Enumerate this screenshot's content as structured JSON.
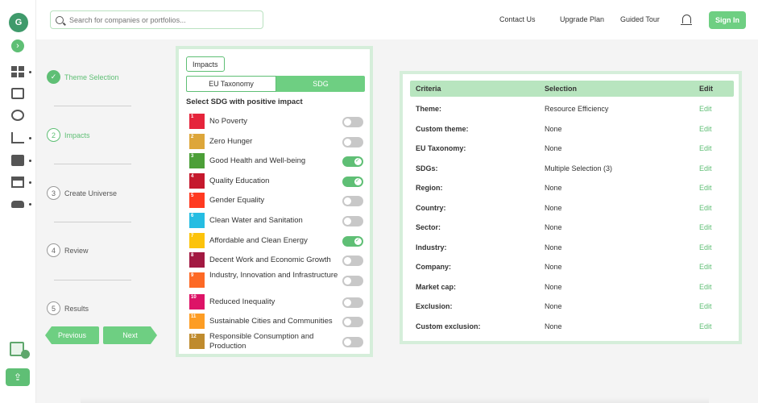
{
  "brand": {
    "logo_text": "G"
  },
  "header": {
    "search_placeholder": "Search for companies or portfolios...",
    "nav": [
      "Contact Us",
      "Upgrade Plan",
      "Guided Tour"
    ],
    "signin_label": "Sign In"
  },
  "steps": [
    {
      "num": "",
      "label": "Theme Selection",
      "state": "done"
    },
    {
      "num": "2",
      "label": "Impacts",
      "state": "active"
    },
    {
      "num": "3",
      "label": "Create Universe",
      "state": "todo"
    },
    {
      "num": "4",
      "label": "Review",
      "state": "todo"
    },
    {
      "num": "5",
      "label": "Results",
      "state": "todo"
    }
  ],
  "nav_buttons": {
    "previous": "Previous",
    "next": "Next"
  },
  "impacts_panel": {
    "tag": "Impacts",
    "tabs": [
      "EU Taxonomy",
      "SDG"
    ],
    "active_tab": "SDG",
    "heading": "Select SDG with positive impact",
    "goals": [
      {
        "num": "1",
        "name": "No Poverty",
        "color": "#e5243b",
        "on": false
      },
      {
        "num": "2",
        "name": "Zero Hunger",
        "color": "#dda63a",
        "on": false
      },
      {
        "num": "3",
        "name": "Good Health and Well-being",
        "color": "#4c9f38",
        "on": true
      },
      {
        "num": "4",
        "name": "Quality Education",
        "color": "#c5192d",
        "on": true
      },
      {
        "num": "5",
        "name": "Gender Equality",
        "color": "#ff3a21",
        "on": false
      },
      {
        "num": "6",
        "name": "Clean Water and Sanitation",
        "color": "#26bde2",
        "on": false
      },
      {
        "num": "7",
        "name": "Affordable and Clean Energy",
        "color": "#fcc30b",
        "on": true
      },
      {
        "num": "8",
        "name": "Decent Work and Economic Growth",
        "color": "#a21942",
        "on": false
      },
      {
        "num": "9",
        "name": "Industry, Innovation and Infrastructure",
        "color": "#fd6925",
        "on": false
      },
      {
        "num": "10",
        "name": "Reduced Inequality",
        "color": "#dd1367",
        "on": false
      },
      {
        "num": "11",
        "name": "Sustainable Cities and Communities",
        "color": "#fd9d24",
        "on": false
      },
      {
        "num": "12",
        "name": "Responsible Consumption and Production",
        "color": "#bf8b2e",
        "on": false
      }
    ]
  },
  "criteria_panel": {
    "headers": {
      "criteria": "Criteria",
      "selection": "Selection",
      "edit": "Edit"
    },
    "rows": [
      {
        "criteria": "Theme:",
        "selection": "Resource Efficiency",
        "edit": "Edit"
      },
      {
        "criteria": "Custom theme:",
        "selection": "None",
        "edit": "Edit"
      },
      {
        "criteria": "EU Taxonomy:",
        "selection": "None",
        "edit": "Edit"
      },
      {
        "criteria": "SDGs:",
        "selection": "Multiple Selection (3)",
        "edit": "Edit"
      },
      {
        "criteria": "Region:",
        "selection": "None",
        "edit": "Edit"
      },
      {
        "criteria": "Country:",
        "selection": "None",
        "edit": "Edit"
      },
      {
        "criteria": "Sector:",
        "selection": "None",
        "edit": "Edit"
      },
      {
        "criteria": "Industry:",
        "selection": "None",
        "edit": "Edit"
      },
      {
        "criteria": "Company:",
        "selection": "None",
        "edit": "Edit"
      },
      {
        "criteria": "Market cap:",
        "selection": "None",
        "edit": "Edit"
      },
      {
        "criteria": "Exclusion:",
        "selection": "None",
        "edit": "Edit"
      },
      {
        "criteria": "Custom exclusion:",
        "selection": "None",
        "edit": "Edit"
      }
    ]
  }
}
